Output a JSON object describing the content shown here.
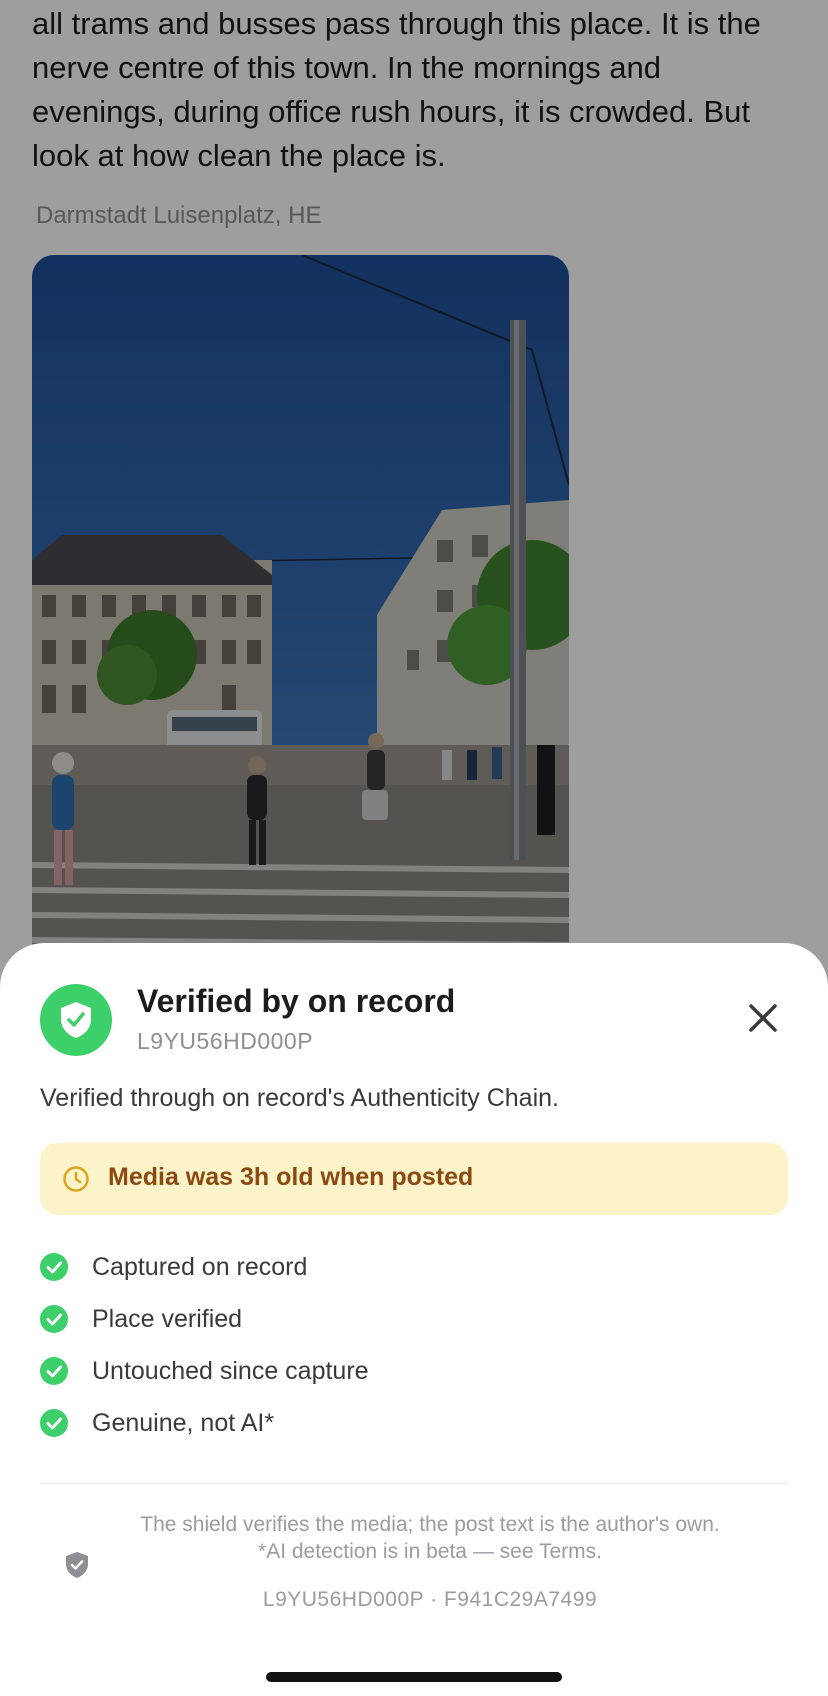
{
  "post": {
    "text": "all trams and busses pass through this place. It is the nerve centre of this town. In the mornings and evenings, during office rush hours, it is crowded. But look at how clean the place is.",
    "location": "Darmstadt Luisenplatz, HE"
  },
  "sheet": {
    "title": "Verified by on record",
    "code": "L9YU56HD000P",
    "description": "Verified through on record's Authenticity Chain.",
    "age_banner": "Media was 3h old when posted",
    "checks": [
      {
        "label": "Captured on record"
      },
      {
        "label": "Place verified"
      },
      {
        "label": "Untouched since capture"
      },
      {
        "label": "Genuine, not AI*"
      }
    ],
    "footer_line1": "The shield verifies the media; the post text is the author's own.",
    "footer_line2": "*AI detection is in beta — see Terms.",
    "footer_ids": "L9YU56HD000P · F941C29A7499"
  },
  "colors": {
    "verified_green": "#3ccf6a",
    "banner_bg": "#fdf3c8",
    "banner_text": "#8a4a12"
  }
}
